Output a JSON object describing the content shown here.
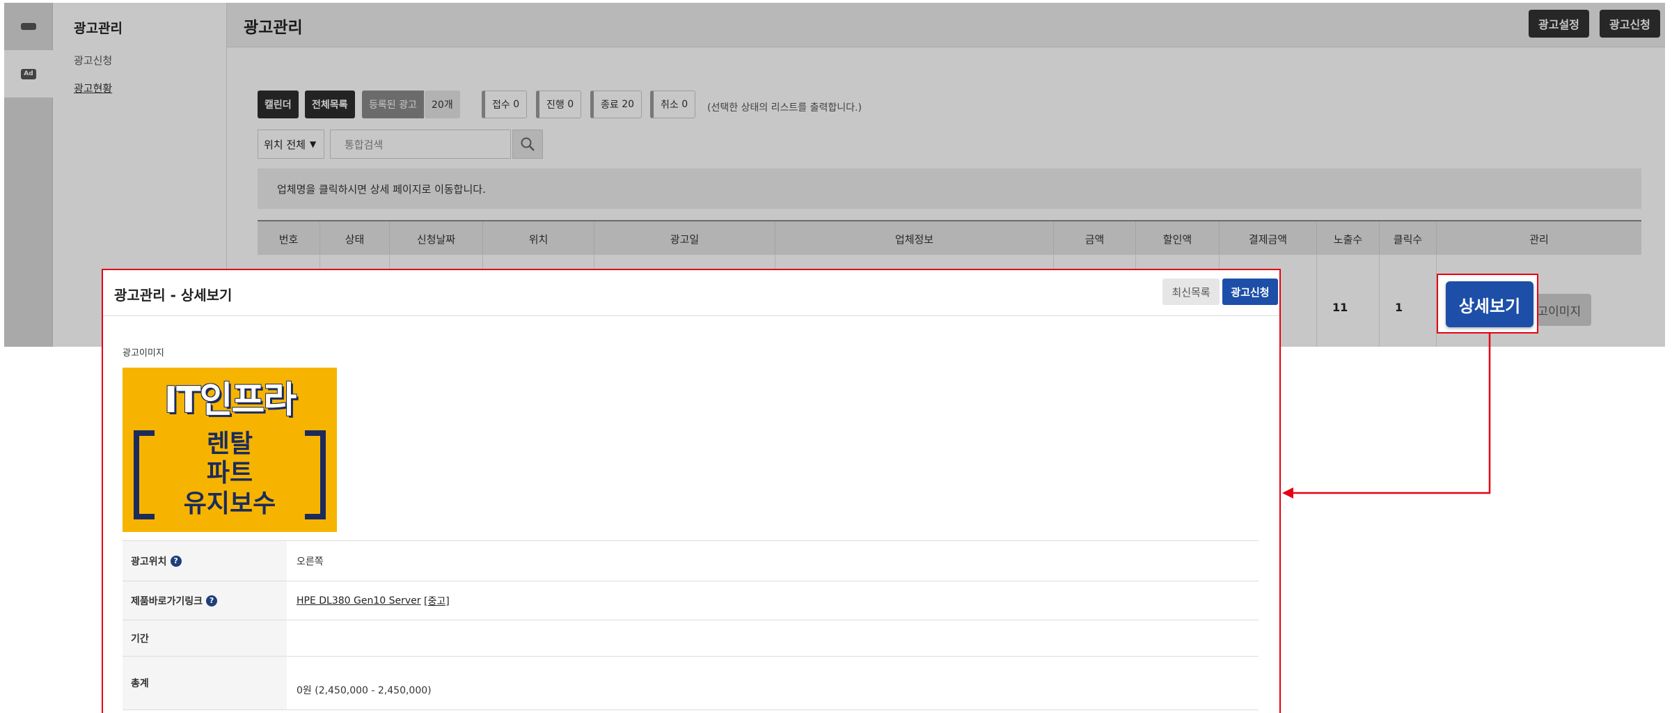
{
  "sidebar": {
    "title": "광고관리",
    "items": [
      {
        "label": "광고신청"
      },
      {
        "label": "광고현황"
      }
    ],
    "icons": [
      "store-icon",
      "ad-icon"
    ],
    "ad_icon_text": "Ad"
  },
  "header": {
    "title": "광고관리",
    "settings_button": "광고설정",
    "apply_button": "광고신청"
  },
  "filters": {
    "calendar": "캘린더",
    "all_list": "전체목록",
    "registered": "등록된 광고",
    "registered_count": "20개",
    "status": [
      {
        "label": "접수",
        "count": "0"
      },
      {
        "label": "진행",
        "count": "0"
      },
      {
        "label": "종료",
        "count": "20"
      },
      {
        "label": "취소",
        "count": "0"
      }
    ],
    "status_note": "(선택한 상태의 리스트를 출력합니다.)"
  },
  "search": {
    "location_select": "위치 전체",
    "placeholder": "통합검색"
  },
  "notice": "업체명을 클릭하시면 상세 페이지로 이동합니다.",
  "table": {
    "columns": [
      "번호",
      "상태",
      "신청날짜",
      "위치",
      "광고일",
      "업체정보",
      "금액",
      "할인액",
      "결제금액",
      "노출수",
      "클릭수",
      "관리"
    ],
    "row": {
      "views": "11",
      "clicks": "1",
      "detail_button": "상세보기",
      "image_button": "광고이미지"
    }
  },
  "modal": {
    "title": "광고관리 - 상세보기",
    "latest_button": "최신목록",
    "apply_button": "광고신청",
    "image_label": "광고이미지",
    "ad_image": {
      "line1": "IT인프라",
      "line2": "렌탈",
      "line3": "파트",
      "line4": "유지보수"
    },
    "info": {
      "position_label": "광고위치",
      "position_value": "오른쪽",
      "link_label": "제품바로가기링크",
      "link_value": "HPE DL380 Gen10 Server",
      "link_tag": "[중고]",
      "period_label": "기간",
      "period_value": "",
      "total_label": "총계",
      "total_value": "0원 (2,450,000 - 2,450,000)"
    }
  },
  "colors": {
    "accent_red": "#e60012",
    "primary_blue": "#1d4fa8",
    "ad_yellow": "#f6b400",
    "ad_navy": "#1b2b5c"
  }
}
